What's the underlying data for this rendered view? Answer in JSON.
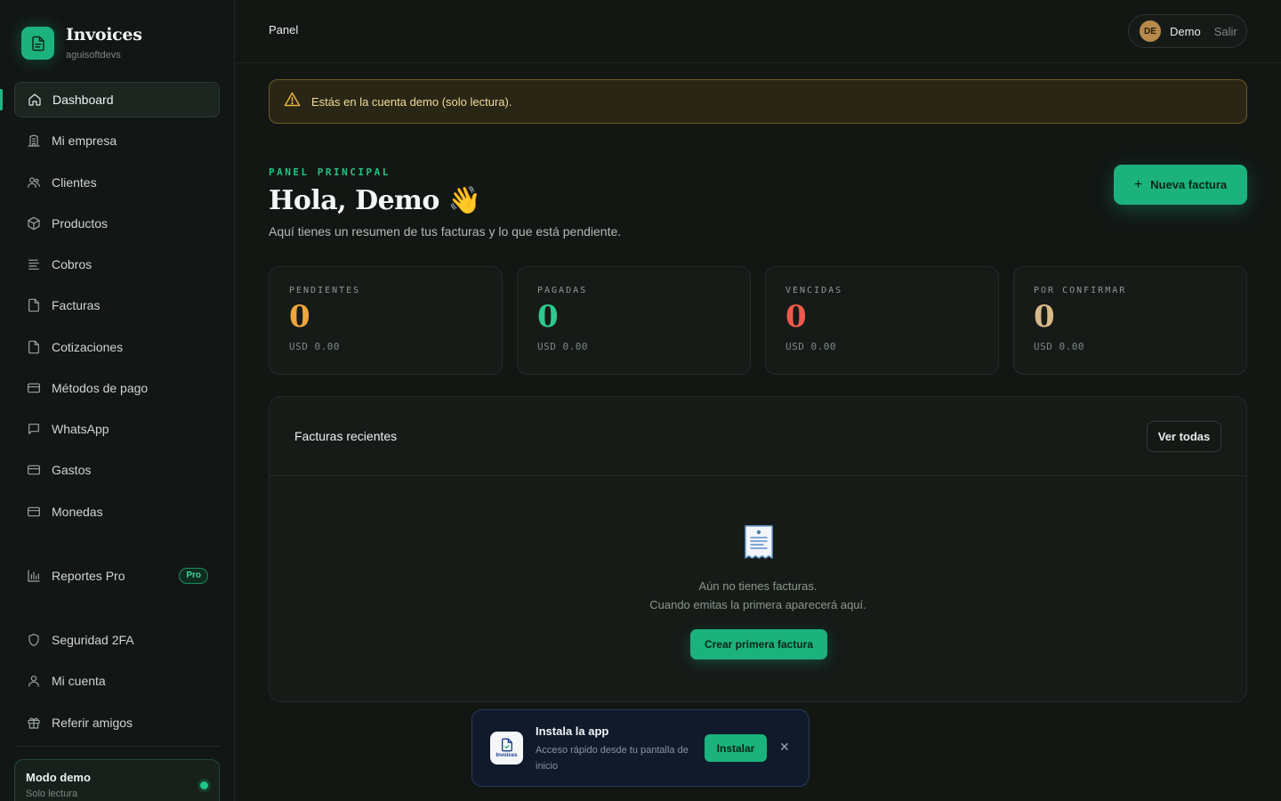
{
  "brand": {
    "title": "Invoices",
    "subtitle": "aguisoftdevs"
  },
  "nav": {
    "items": [
      {
        "label": "Dashboard",
        "icon": "home-icon"
      },
      {
        "label": "Mi empresa",
        "icon": "building-icon"
      },
      {
        "label": "Clientes",
        "icon": "users-icon"
      },
      {
        "label": "Productos",
        "icon": "box-icon"
      },
      {
        "label": "Cobros",
        "icon": "list-icon"
      },
      {
        "label": "Facturas",
        "icon": "file-icon"
      },
      {
        "label": "Cotizaciones",
        "icon": "file-icon"
      },
      {
        "label": "Métodos de pago",
        "icon": "card-icon"
      },
      {
        "label": "WhatsApp",
        "icon": "chat-icon"
      },
      {
        "label": "Gastos",
        "icon": "card-icon"
      },
      {
        "label": "Monedas",
        "icon": "card-icon"
      },
      {
        "label": "Reportes Pro",
        "icon": "bar-chart-icon",
        "badge": "Pro"
      },
      {
        "label": "Seguridad 2FA",
        "icon": "shield-icon"
      },
      {
        "label": "Mi cuenta",
        "icon": "user-icon"
      },
      {
        "label": "Referir amigos",
        "icon": "gift-icon"
      }
    ]
  },
  "demo_card": {
    "title": "Modo demo",
    "subtitle": "Solo lectura"
  },
  "topbar": {
    "breadcrumb": "Panel",
    "avatar_initials": "DE",
    "user_name": "Demo",
    "logout_label": "Salir"
  },
  "alert": {
    "text": "Estás en la cuenta demo (solo lectura)."
  },
  "header": {
    "eyebrow": "PANEL PRINCIPAL",
    "greeting": "Hola, Demo 👋",
    "subtitle": "Aquí tienes un resumen de tus facturas y lo que está pendiente.",
    "new_invoice_label": "Nueva factura"
  },
  "stats": [
    {
      "label": "PENDIENTES",
      "value": "0",
      "amount": "USD 0.00",
      "color": "#f0a53a"
    },
    {
      "label": "PAGADAS",
      "value": "0",
      "amount": "USD 0.00",
      "color": "#2ec98f"
    },
    {
      "label": "VENCIDAS",
      "value": "0",
      "amount": "USD 0.00",
      "color": "#ef5a4b"
    },
    {
      "label": "POR CONFIRMAR",
      "value": "0",
      "amount": "USD 0.00",
      "color": "#d9b98a"
    }
  ],
  "recent": {
    "title": "Facturas recientes",
    "see_all_label": "Ver todas",
    "empty_line1": "Aún no tienes facturas.",
    "empty_line2": "Cuando emitas la primera aparecerá aquí.",
    "create_label": "Crear primera factura"
  },
  "install_toast": {
    "icon_text": "Invoices",
    "title": "Instala la app",
    "subtitle": "Acceso rápido desde tu pantalla de inicio",
    "install_label": "Instalar",
    "close_glyph": "✕"
  },
  "colors": {
    "accent": "#1cb27d",
    "background": "#121714",
    "warning": "#f0dd9a"
  }
}
